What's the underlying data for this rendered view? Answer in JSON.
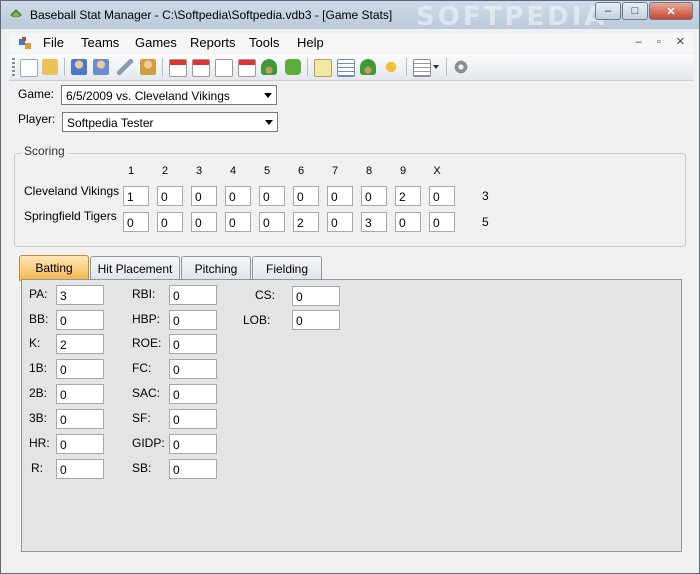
{
  "window": {
    "title": "Baseball Stat Manager - C:\\Softpedia\\Softpedia.vdb3 - [Game Stats]",
    "watermark": "SOFTPEDIA",
    "minimize_glyph": "–",
    "maximize_glyph": "□",
    "close_glyph": "✕"
  },
  "menu": {
    "items": [
      "File",
      "Teams",
      "Games",
      "Reports",
      "Tools",
      "Help"
    ],
    "mdi_controls": "– ▫ ✕"
  },
  "toolbar": {
    "icons": [
      "new-icon",
      "open-icon",
      "player-icon",
      "player-edit-icon",
      "wrench-icon",
      "users-icon",
      "calendar-icon",
      "schedule-edit-icon",
      "edit-doc-icon",
      "export-icon",
      "field-icon",
      "puzzle-icon",
      "report-icon",
      "table-icon",
      "ball-glove-icon",
      "medal-icon",
      "list-icon",
      "dropdown-icon",
      "settings-icon"
    ]
  },
  "form": {
    "game_label": "Game:",
    "game_value": "6/5/2009 vs. Cleveland Vikings",
    "player_label": "Player:",
    "player_value": "Softpedia Tester"
  },
  "scoring": {
    "title": "Scoring",
    "innings": [
      "1",
      "2",
      "3",
      "4",
      "5",
      "6",
      "7",
      "8",
      "9",
      "X"
    ],
    "teams": [
      {
        "name": "Cleveland Vikings",
        "scores": [
          "1",
          "0",
          "0",
          "0",
          "0",
          "0",
          "0",
          "0",
          "2",
          "0"
        ],
        "total": "3"
      },
      {
        "name": "Springfield Tigers",
        "scores": [
          "0",
          "0",
          "0",
          "0",
          "0",
          "2",
          "0",
          "3",
          "0",
          "0"
        ],
        "total": "5"
      }
    ]
  },
  "tabs": [
    "Batting",
    "Hit Placement",
    "Pitching",
    "Fielding"
  ],
  "batting": {
    "col1": [
      {
        "label": "PA:",
        "value": "3"
      },
      {
        "label": "BB:",
        "value": "0"
      },
      {
        "label": "K:",
        "value": "2"
      },
      {
        "label": "1B:",
        "value": "0"
      },
      {
        "label": "2B:",
        "value": "0"
      },
      {
        "label": "3B:",
        "value": "0"
      },
      {
        "label": "HR:",
        "value": "0"
      },
      {
        "label": "R:",
        "value": "0"
      }
    ],
    "col2": [
      {
        "label": "RBI:",
        "value": "0"
      },
      {
        "label": "HBP:",
        "value": "0"
      },
      {
        "label": "ROE:",
        "value": "0"
      },
      {
        "label": "FC:",
        "value": "0"
      },
      {
        "label": "SAC:",
        "value": "0"
      },
      {
        "label": "SF:",
        "value": "0"
      },
      {
        "label": "GIDP:",
        "value": "0"
      },
      {
        "label": "SB:",
        "value": "0"
      }
    ],
    "col3": [
      {
        "label": "CS:",
        "value": "0"
      },
      {
        "label": "LOB:",
        "value": "0"
      }
    ]
  },
  "colors": {
    "active_tab": "#f5b54a",
    "titlebar": "#c4d3e2",
    "close_button": "#c7452f"
  }
}
